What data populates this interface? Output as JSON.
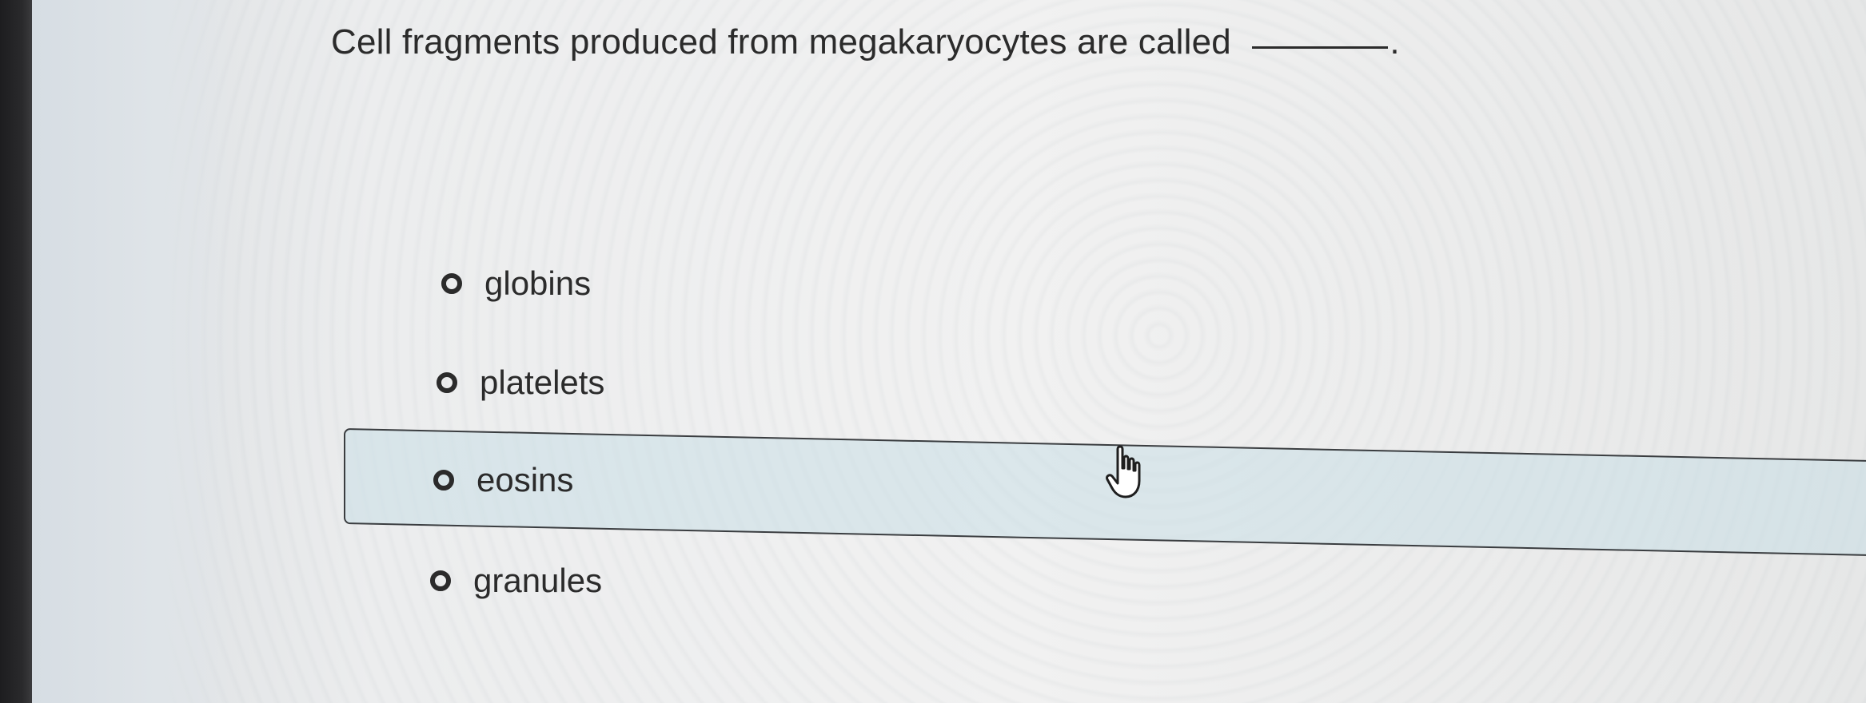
{
  "question": {
    "text": "Cell fragments produced from megakaryocytes are called",
    "blank_suffix": "."
  },
  "options": [
    {
      "label": "globins"
    },
    {
      "label": "platelets"
    },
    {
      "label": "eosins"
    },
    {
      "label": "granules"
    }
  ],
  "cursor": {
    "icon": "hand-pointer-icon"
  },
  "colors": {
    "text": "#2b2b2b",
    "hover_background": "#c8dee6",
    "hover_border": "#3a3d40"
  }
}
